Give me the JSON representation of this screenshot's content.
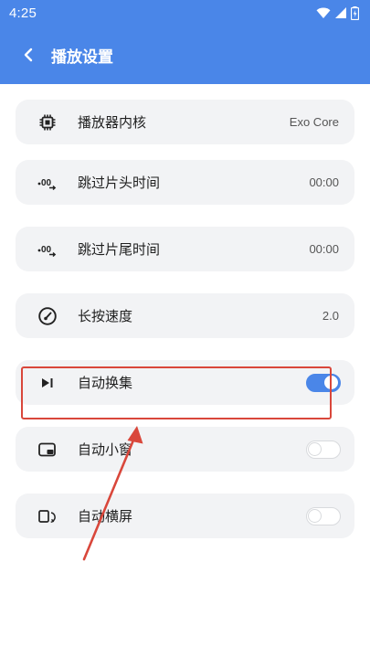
{
  "status_bar": {
    "time": "4:25"
  },
  "app_bar": {
    "title": "播放设置"
  },
  "settings": [
    {
      "label": "播放器内核",
      "value": "Exo Core",
      "icon": "chip-icon"
    },
    {
      "label": "跳过片头时间",
      "value": "00:00",
      "icon": "skip-time-icon"
    },
    {
      "label": "跳过片尾时间",
      "value": "00:00",
      "icon": "skip-time-icon"
    },
    {
      "label": "长按速度",
      "value": "2.0",
      "icon": "speedometer-icon"
    },
    {
      "label": "自动换集",
      "toggle_on": true,
      "icon": "skip-next-icon"
    },
    {
      "label": "自动小窗",
      "toggle_on": false,
      "icon": "picture-in-picture-icon"
    },
    {
      "label": "自动横屏",
      "toggle_on": false,
      "icon": "rotate-screen-icon"
    }
  ],
  "colors": {
    "primary": "#4a86e8",
    "card_bg": "#f2f3f5",
    "annotation": "#d9473b"
  }
}
